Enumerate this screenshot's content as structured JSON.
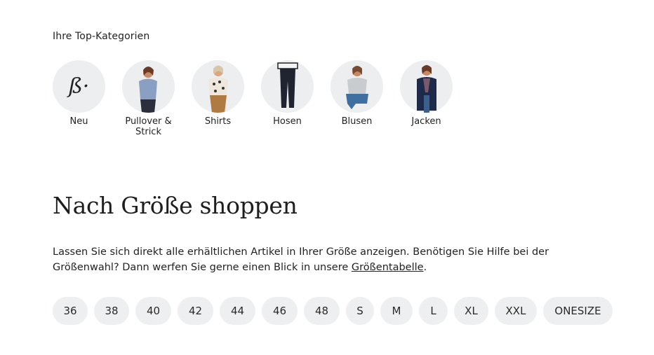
{
  "top_categories": {
    "title": "Ihre Top-Kategorien",
    "items": [
      {
        "label": "Neu",
        "icon": "brand-logo-icon"
      },
      {
        "label": "Pullover & Strick",
        "icon": "pullover-image"
      },
      {
        "label": "Shirts",
        "icon": "shirts-image"
      },
      {
        "label": "Hosen",
        "icon": "hosen-image"
      },
      {
        "label": "Blusen",
        "icon": "blusen-image"
      },
      {
        "label": "Jacken",
        "icon": "jacken-image"
      }
    ],
    "logo_letter": "ß·"
  },
  "size_section": {
    "title": "Nach Größe shoppen",
    "description_text": "Lassen Sie sich direkt alle erhältlichen Artikel in Ihrer Größe anzeigen. Benötigen Sie Hilfe bei der Größenwahl? Dann werfen Sie gerne einen Blick in unsere ",
    "link_label": "Größentabelle",
    "description_end": ".",
    "sizes": [
      "36",
      "38",
      "40",
      "42",
      "44",
      "46",
      "48",
      "S",
      "M",
      "L",
      "XL",
      "XXL",
      "ONESIZE"
    ]
  },
  "colors": {
    "pill_bg": "#eeeff1",
    "circle_bg": "#eceef0",
    "text": "#1e1e1e"
  }
}
